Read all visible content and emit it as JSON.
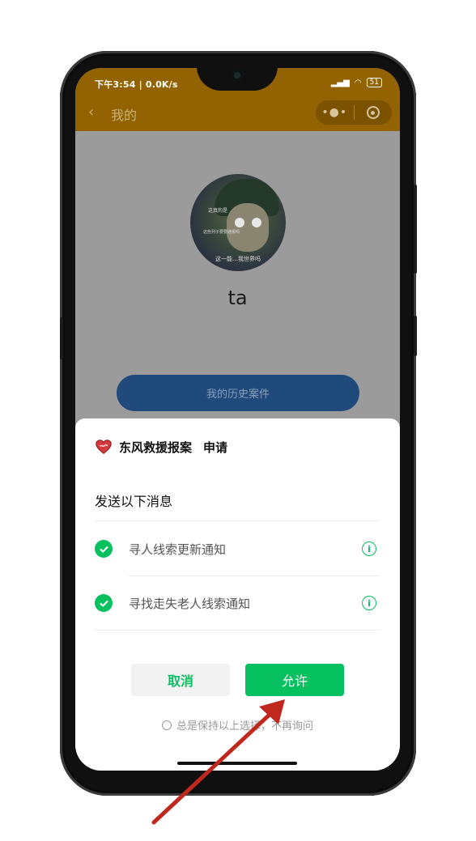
{
  "status_bar": {
    "time_speed": "下午3:54 | 0.0K/s",
    "battery": "51"
  },
  "title_bar": {
    "title": "我的",
    "more_icon": "more-dots-icon",
    "close_icon": "target-close-icon"
  },
  "profile": {
    "avatar_caption": "这一能…我世界吗",
    "avatar_line1": "这真的是",
    "avatar_line2": "这些列子要要通报吗",
    "username": "ta",
    "history_button": "我的历史案件"
  },
  "sheet": {
    "app_name": "东风救援报案",
    "action": "申请",
    "send_title": "发送以下消息",
    "messages": [
      {
        "label": "寻人线索更新通知",
        "checked": true
      },
      {
        "label": "寻找走失老人线索通知",
        "checked": true
      }
    ],
    "cancel_label": "取消",
    "allow_label": "允许",
    "always_label": "总是保持以上选择，不再询问"
  },
  "colors": {
    "accent_green": "#07c160",
    "topbar_brown": "#926300",
    "history_blue": "#1f4a7b",
    "arrow_red": "#c0281e"
  }
}
